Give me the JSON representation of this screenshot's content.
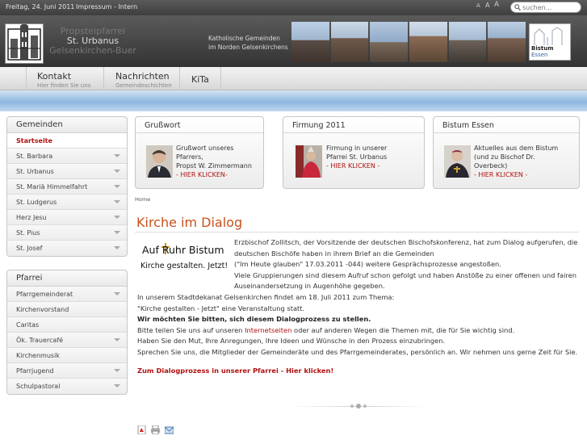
{
  "topbar": {
    "date": "Freitag, 24. Juni 2011",
    "links": "Impressum - Intern",
    "font_small": "A",
    "font_medium": "A",
    "font_large": "A",
    "search_placeholder": "suchen..."
  },
  "header": {
    "parish_line1": "Propsteipfarrei",
    "parish_name": "St. Urbanus",
    "parish_line3": "Gelsenkirchen-Buer",
    "tagline_1": "Katholische Gemeinden",
    "tagline_2": "im Norden Gelsenkirchens",
    "bistum_prefix": "Bistum",
    "bistum_name": "Essen"
  },
  "nav": [
    {
      "title": "Kontakt",
      "sub": "Hier finden Sie uns"
    },
    {
      "title": "Nachrichten",
      "sub": "Gemeindeschichten"
    },
    {
      "title": "KiTa",
      "sub": ""
    }
  ],
  "sidebar": {
    "gemeinden": {
      "title": "Gemeinden",
      "items": [
        "Startseite",
        "St. Barbara",
        "St. Urbanus",
        "St. Mariä Himmelfahrt",
        "St. Ludgerus",
        "Herz Jesu",
        "St. Pius",
        "St. Josef"
      ]
    },
    "pfarrei": {
      "title": "Pfarrei",
      "items": [
        "Pfarrgemeinderat",
        "Kirchenvorstand",
        "Caritas",
        "Ök. Trauercafé",
        "Kirchenmusik",
        "Pfarrjugend",
        "Schulpastoral"
      ]
    }
  },
  "cards": [
    {
      "title": "Grußwort",
      "title_bold": "",
      "line1": "Grußwort unseres Pfarrers,",
      "line2": "Propst W. Zimmermann",
      "link": "- HIER KLICKEN-"
    },
    {
      "title": "Firmung",
      "title_bold": "2011",
      "line1": "Firmung in unserer",
      "line2": "Pfarrei St. Urbanus",
      "link": "- HIER KLICKEN -"
    },
    {
      "title": "Bistum",
      "title_bold": "Essen",
      "line1": "Aktuelles aus dem Bistum",
      "line2": "(und zu Bischof Dr. Overbeck)",
      "link": "- HIER KLICKEN -"
    }
  ],
  "breadcrumb": "Home",
  "article": {
    "title": "Kirche im Dialog",
    "logo_line1": "Auf Ruhr Bistum",
    "logo_line2": "Kirche gestalten. Jetzt!",
    "p1": "Erzbischof Zollitsch, der Vorsitzende der deutschen Bischofskonferenz, hat zum Dialog aufgerufen, die",
    "p2": "deutschen Bischöfe haben in ihrem Brief an die Gemeinden",
    "p3": "(\"Im Heute glauben\" 17.03.2011 -044) weitere Gesprächsprozesse angestoßen.",
    "p4": "Viele Gruppierungen sind diesem Aufruf schon gefolgt und haben Anstöße zu einer offenen und fairen",
    "p5": "Auseinandersetzung in Augenhöhe gegeben.",
    "p6": "In unserem Stadtdekanat Gelsenkirchen findet am 18. Juli 2011 zum Thema:",
    "p7": "\"Kirche gestalten - Jetzt\" eine Veranstaltung statt.",
    "p8": "Wir möchten Sie bitten, sich diesem Dialogprozess zu stellen.",
    "p9_pre": "Bitte teilen Sie uns auf unseren ",
    "p9_link": "Internetseiten",
    "p9_post": " oder auf anderen Wegen die Themen mit, die für Sie wichtig sind.",
    "p10": "Haben Sie den Mut, Ihre Anregungen, Ihre Ideen und Wünsche in den Prozess einzubringen.",
    "p11": "Sprechen Sie uns, die Mitglieder der Gemeinderäte und des Pfarrgemeinderates, persönlich an. Wir nehmen uns gerne Zeit für Sie.",
    "cta": "Zum Dialogprozess in unserer Pfarrei - Hier klicken!"
  }
}
